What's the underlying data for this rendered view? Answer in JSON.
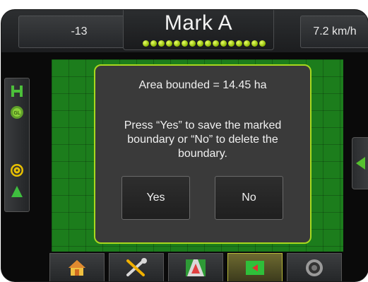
{
  "header": {
    "left_value": "-13",
    "title": "Mark A",
    "speed": "7.2 km/h",
    "indicator_count": 16,
    "indicator_color": "#b8e010"
  },
  "dialog": {
    "area_text": "Area bounded = 14.45 ha",
    "message": "Press “Yes” to save the marked boundary or “No” to delete the boundary.",
    "yes_label": "Yes",
    "no_label": "No",
    "border_color": "#a8d81e"
  },
  "left_panel": {
    "icons": [
      "field-marker-icon",
      "gps-status-icon",
      "steering-icon",
      "vehicle-icon"
    ]
  },
  "right_panel": {
    "icon": "expand-arrow-icon"
  },
  "bottom_nav": {
    "tabs": [
      {
        "icon": "home-icon",
        "active": false
      },
      {
        "icon": "tools-icon",
        "active": false
      },
      {
        "icon": "guidance-icon",
        "active": false
      },
      {
        "icon": "field-map-icon",
        "active": true
      },
      {
        "icon": "camera-icon",
        "active": false
      }
    ]
  },
  "colors": {
    "field": "#1c7d1c",
    "accent": "#a8d81e"
  }
}
